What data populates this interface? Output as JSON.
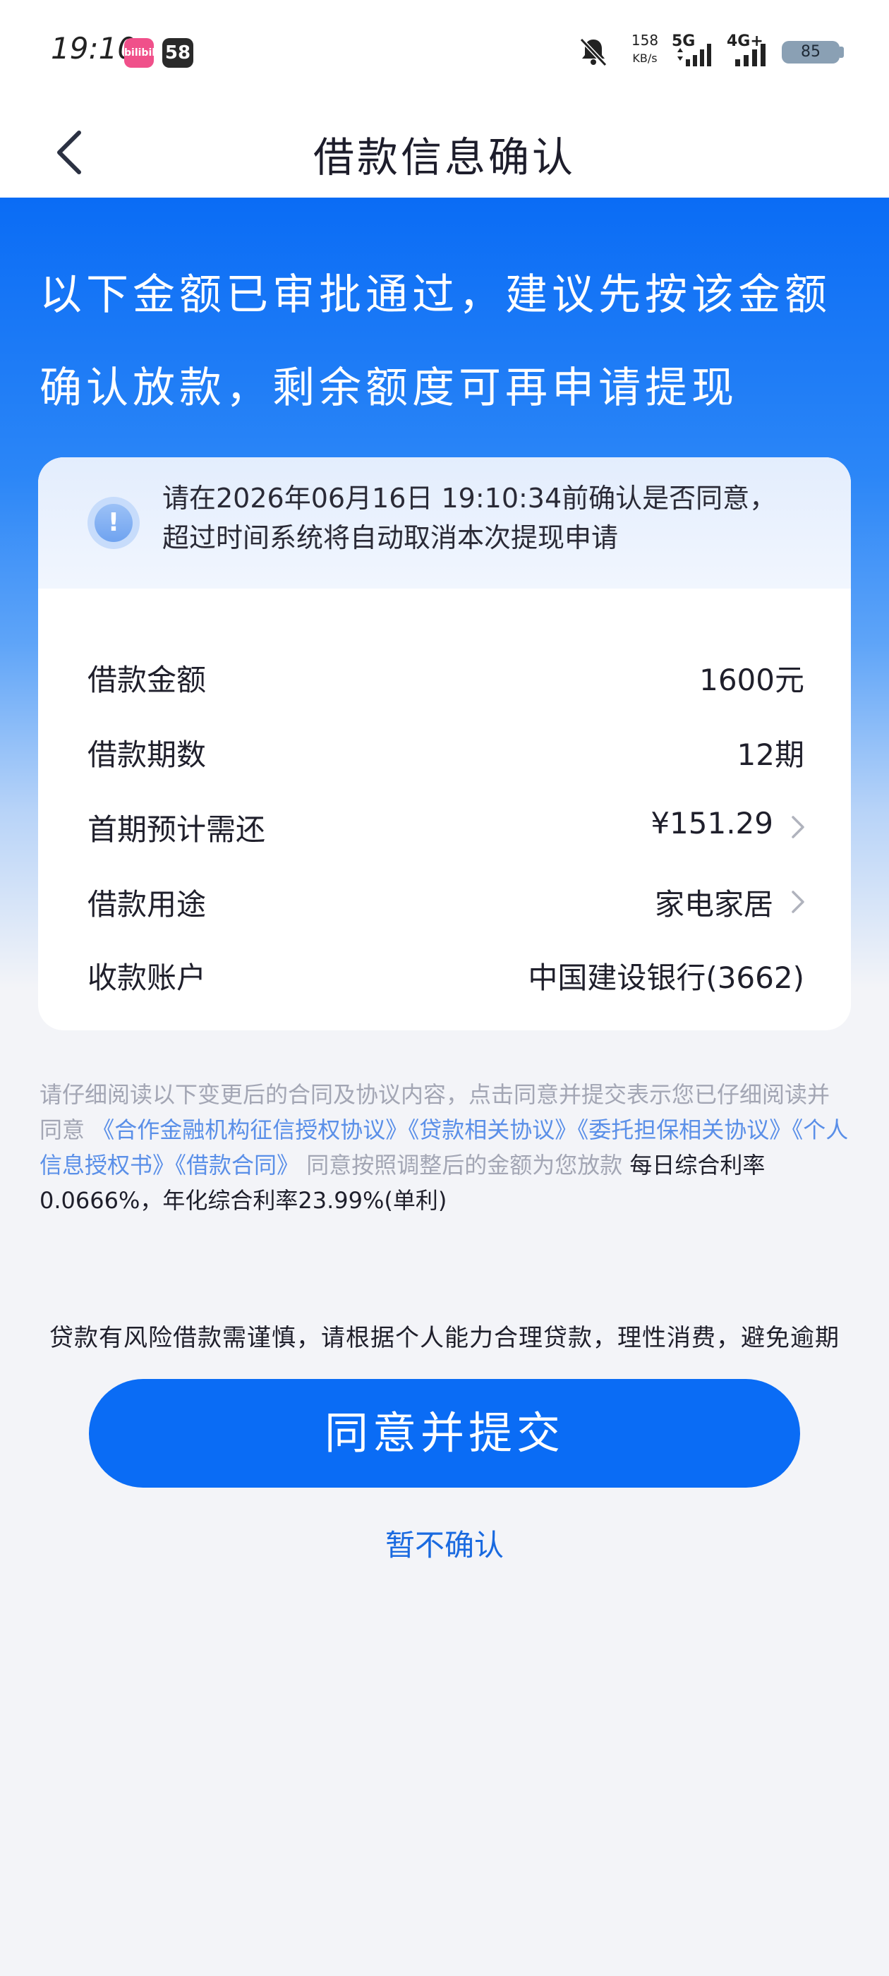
{
  "status_bar": {
    "time": "19:10",
    "app_badge_1": "bilibili",
    "app_badge_2": "58",
    "net_speed": "158",
    "net_speed_unit": "KB/s",
    "net_1": "5G",
    "net_2": "4G+",
    "battery": "85"
  },
  "nav": {
    "title": "借款信息确认"
  },
  "hero": {
    "message": "以下金额已审批通过，建议先按该金额确认放款，剩余额度可再申请提现"
  },
  "notice": {
    "text": "请在2026年06月16日 19:10:34前确认是否同意，超过时间系统将自动取消本次提现申请"
  },
  "details": [
    {
      "label": "借款金额",
      "value": "1600元",
      "has_arrow": false
    },
    {
      "label": "借款期数",
      "value": "12期",
      "has_arrow": false
    },
    {
      "label": "首期预计需还",
      "value": "¥151.29",
      "has_arrow": true
    },
    {
      "label": "借款用途",
      "value": "家电家居",
      "has_arrow": true
    },
    {
      "label": "收款账户",
      "value": "中国建设银行(3662)",
      "has_arrow": false
    }
  ],
  "disclaimer": {
    "prefix": "请仔细阅读以下变更后的合同及协议内容，点击同意并提交表示您已仔细阅读并同意 ",
    "links": [
      "《合作金融机构征信授权协议》",
      "《贷款相关协议》",
      "《委托担保相关协议》",
      "《个人信息授权书》",
      "《借款合同》"
    ],
    "suffix": " 同意按照调整后的金额为您放款 ",
    "rate": "每日综合利率0.0666%，年化综合利率23.99%(单利)"
  },
  "risk_notice": "贷款有风险借款需谨慎，请根据个人能力合理贷款，理性消费，避免逾期",
  "actions": {
    "submit": "同意并提交",
    "not_now": "暂不确认"
  },
  "colors": {
    "primary": "#0a6cf5",
    "link": "#5a8fe8",
    "page_bg": "#f3f4f8"
  }
}
